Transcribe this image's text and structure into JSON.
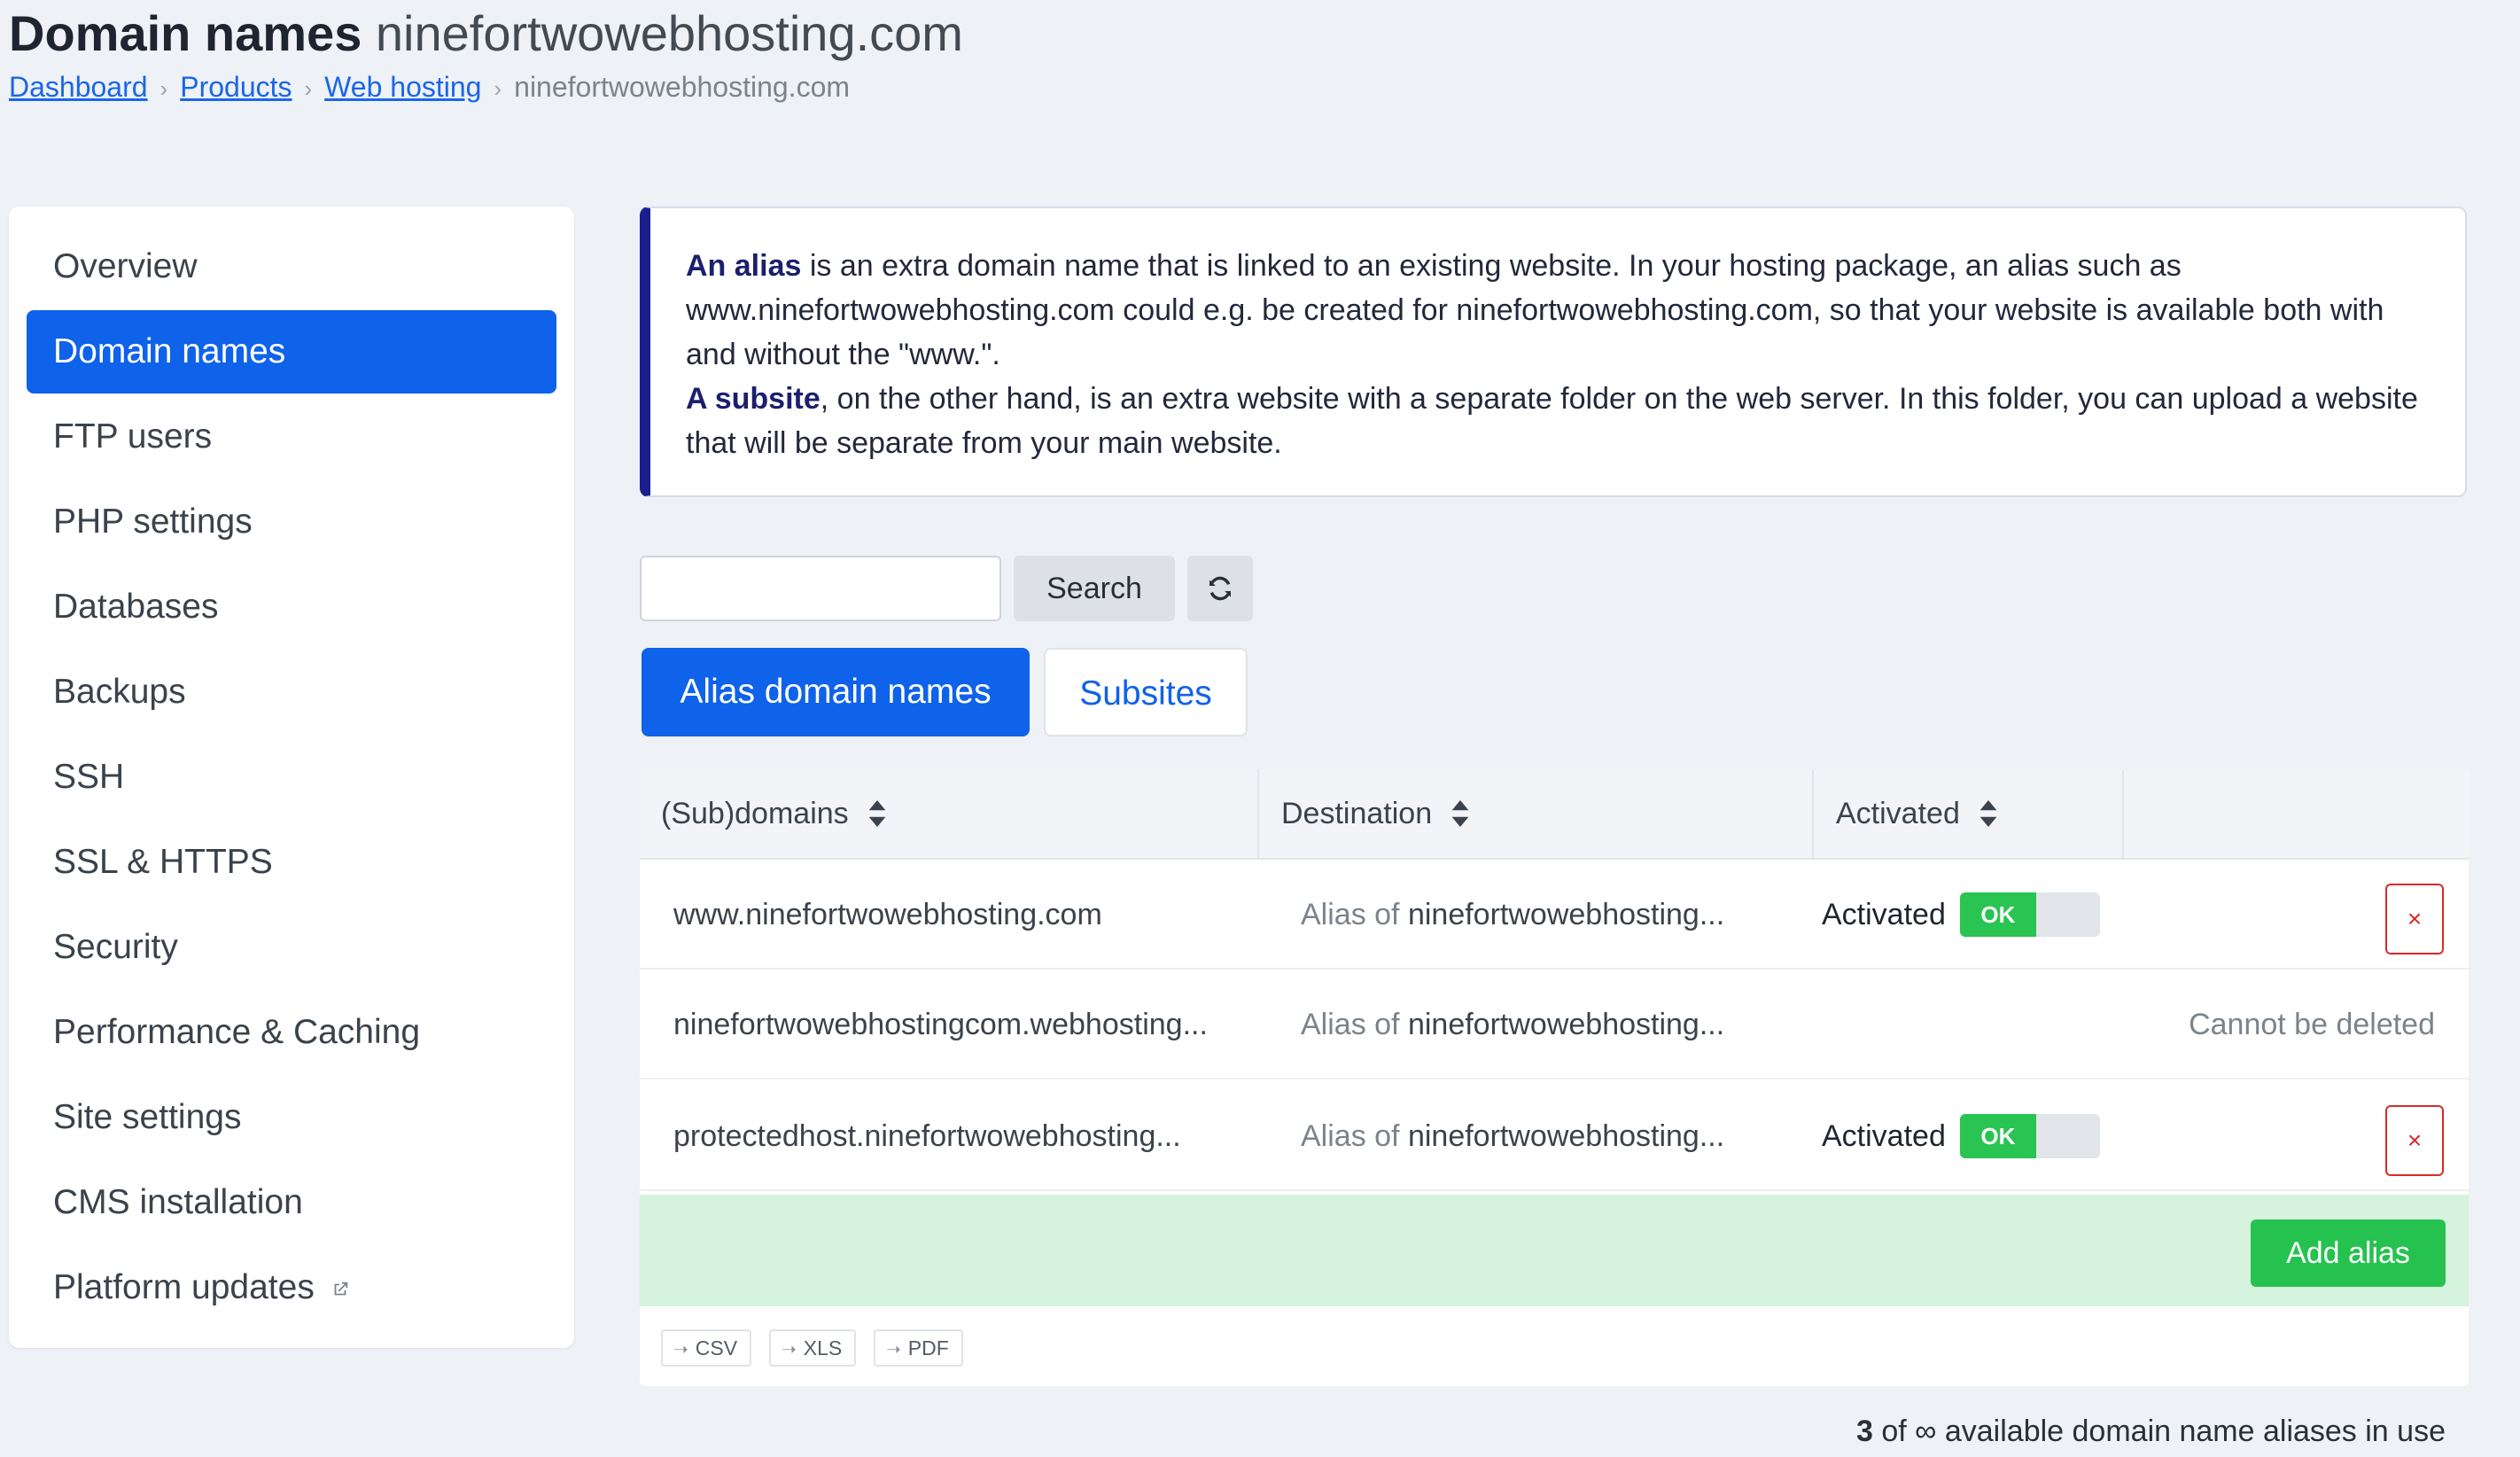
{
  "page": {
    "title": "Domain names",
    "subtitle": "ninefortwowebhosting.com"
  },
  "breadcrumb": {
    "items": [
      "Dashboard",
      "Products",
      "Web hosting"
    ],
    "current": "ninefortwowebhosting.com",
    "separator": "›"
  },
  "sidebar": {
    "items": [
      {
        "label": "Overview"
      },
      {
        "label": "Domain names",
        "active": true
      },
      {
        "label": "FTP users"
      },
      {
        "label": "PHP settings"
      },
      {
        "label": "Databases"
      },
      {
        "label": "Backups"
      },
      {
        "label": "SSH"
      },
      {
        "label": "SSL & HTTPS"
      },
      {
        "label": "Security"
      },
      {
        "label": "Performance & Caching"
      },
      {
        "label": "Site settings"
      },
      {
        "label": "CMS installation"
      },
      {
        "label": "Platform updates",
        "icon": "external-link-icon"
      }
    ]
  },
  "info": {
    "alias_term": "An alias",
    "alias_text": " is an extra domain name that is linked to an existing website. In your hosting package, an alias such as www.ninefortwowebhosting.com could e.g. be created for ninefortwowebhosting.com, so that your website is available both with and without the \"www.\".",
    "subsite_term": "A subsite",
    "subsite_text": ", on the other hand, is an extra website with a separate folder on the web server. In this folder, you can upload a website that will be separate from your main website."
  },
  "search": {
    "value": "",
    "placeholder": "",
    "button_label": "Search",
    "refresh_icon": "refresh-icon"
  },
  "tabs": [
    {
      "label": "Alias domain names",
      "active": true
    },
    {
      "label": "Subsites",
      "active": false
    }
  ],
  "table": {
    "headers": [
      "(Sub)domains",
      "Destination",
      "Activated",
      ""
    ],
    "rows": [
      {
        "domain": "www.ninefortwowebhosting.com",
        "dest_prefix": "Alias of ",
        "dest_name": "ninefortwowebhosting...",
        "activated_label": "Activated",
        "toggle": "OK",
        "delete_icon": "×"
      },
      {
        "domain": "ninefortwowebhostingcom.webhosting...",
        "dest_prefix": "Alias of ",
        "dest_name": "ninefortwowebhosting...",
        "note": "Cannot be deleted"
      },
      {
        "domain": "protectedhost.ninefortwowebhosting...",
        "dest_prefix": "Alias of ",
        "dest_name": "ninefortwowebhosting...",
        "activated_label": "Activated",
        "toggle": "OK",
        "delete_icon": "×"
      }
    ],
    "add_button": "Add alias",
    "exports": [
      "CSV",
      "XLS",
      "PDF"
    ]
  },
  "usage": {
    "count": "3",
    "of": " of ",
    "limit": "∞",
    "text": " available domain name aliases in use"
  },
  "colors": {
    "primary": "#0f62ea",
    "success": "#25c24f",
    "danger": "#d92a2a",
    "info_border": "#1b1f8e"
  }
}
